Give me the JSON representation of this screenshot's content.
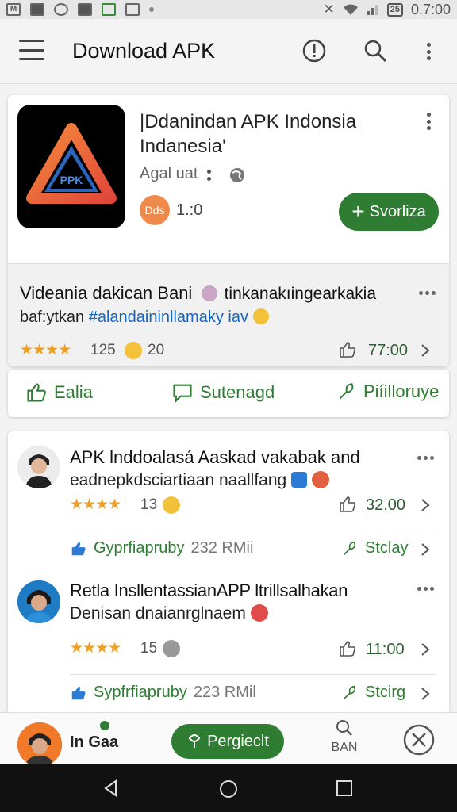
{
  "status": {
    "time": "0.7:00",
    "battery": "25"
  },
  "appbar": {
    "title": "Download APK"
  },
  "app": {
    "title": "|Ddanindan APK Indonsia Indanesia'",
    "developer": "Agal uat",
    "rating_badge": "Dds",
    "rating": "1.:0",
    "install_label": "Svorliza",
    "logo_text": "PPK"
  },
  "featured": {
    "title": "Videania dakican Bani",
    "title_tail": "tinkanakıingearkakia",
    "line2_prefix": "baf:ytkan",
    "line2_tag": "#alandaininllamaky iav",
    "stars": "★★★★",
    "count": "125",
    "count2": "20",
    "price": "77:00"
  },
  "actions": {
    "like": "Ealia",
    "comment": "Sutenagd",
    "share": "Piíilloruye"
  },
  "reviews": [
    {
      "title": "APK lnddoalasá Aaskad vakabak and",
      "body": "eadnepkdsciartiaan naallfang",
      "stars": "★★★★",
      "count": "13",
      "price": "32.00",
      "sub_label": "Gyprfiapruby",
      "sub_meta": "232 RMii",
      "sub_action": "Stclay"
    },
    {
      "title": "Retla InsllentassianAPP ltrillsalhakan",
      "body": "Denisan dnaianrglnaem",
      "stars": "★★★★",
      "count": "15",
      "price": "11:00",
      "sub_label": "Sypfrfiapruby",
      "sub_meta": "223 RMil",
      "sub_action": "Stcirg"
    }
  ],
  "bottom": {
    "user_label": "In Gaa",
    "primary_label": "Pergieclt",
    "search_label": "BAN"
  },
  "colors": {
    "accent_green": "#2e7d32",
    "star": "#f0a020",
    "link_blue": "#1565c0"
  }
}
